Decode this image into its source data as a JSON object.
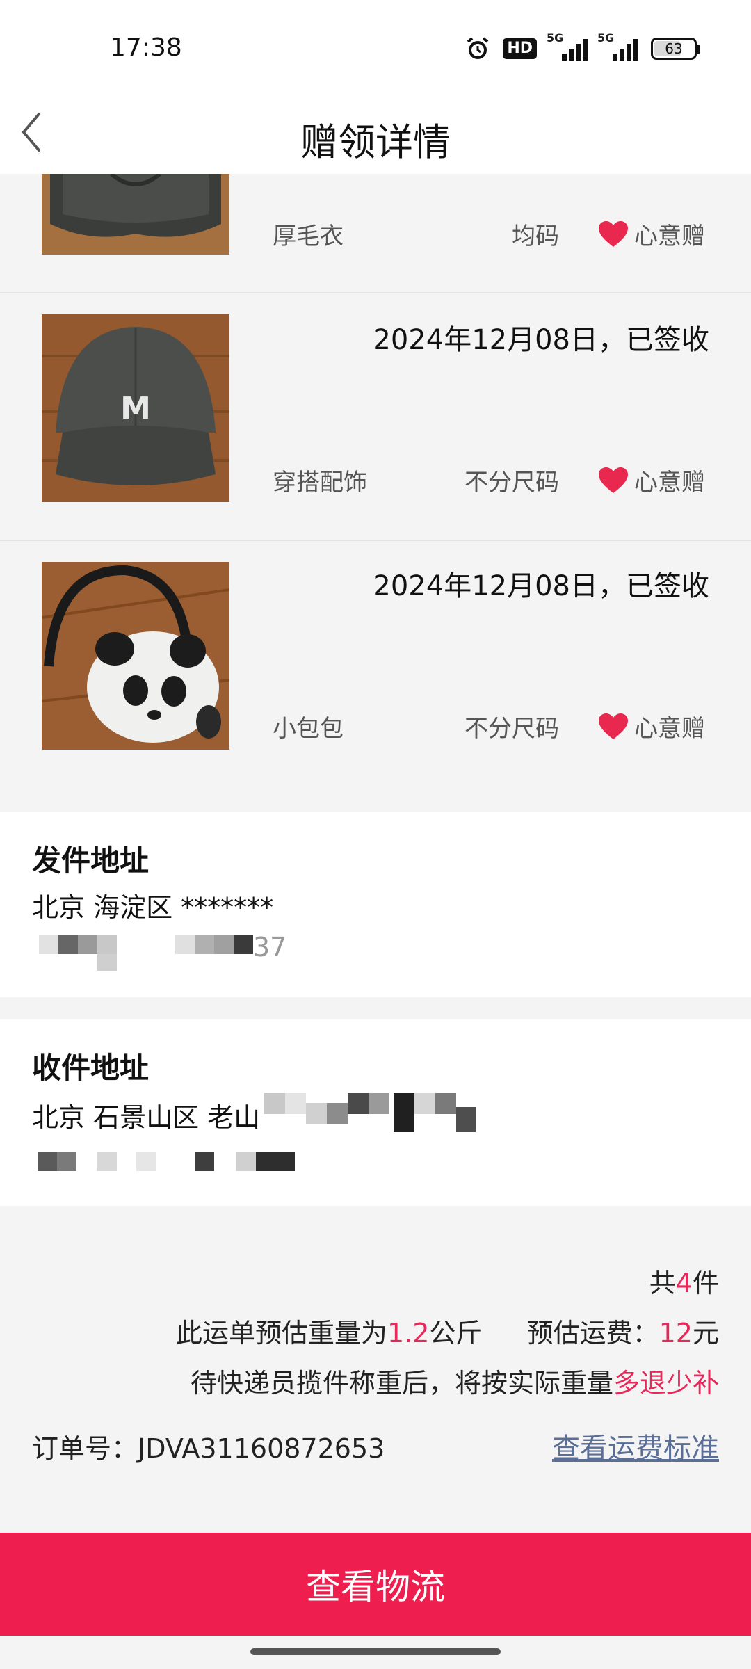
{
  "status_bar": {
    "time": "17:38",
    "hd_label": "HD",
    "network_1": "5G",
    "network_2": "5G",
    "battery": "63"
  },
  "header": {
    "title": "赠领详情",
    "back_icon": "chevron-left-icon"
  },
  "items": [
    {
      "date": "",
      "name": "厚毛衣",
      "size": "均码",
      "tag": "心意赠",
      "thumb": "dark-sweater"
    },
    {
      "date": "2024年12月08日，已签收",
      "name": "穿搭配饰",
      "size": "不分尺码",
      "tag": "心意赠",
      "thumb": "baseball-cap"
    },
    {
      "date": "2024年12月08日，已签收",
      "name": "小包包",
      "size": "不分尺码",
      "tag": "心意赠",
      "thumb": "panda-bag"
    }
  ],
  "sender": {
    "title": "发件地址",
    "line1": "北京 海淀区 *******",
    "line2_visible": "37"
  },
  "receiver": {
    "title": "收件地址",
    "line1": "北京 石景山区 老山"
  },
  "summary": {
    "count_prefix": "共",
    "count": "4",
    "count_suffix": "件",
    "weight_prefix": "此运单预估重量为",
    "weight": "1.2",
    "weight_unit": "公斤",
    "fee_prefix": "预估运费：",
    "fee": "12",
    "fee_unit": "元",
    "note_prefix": "待快递员揽件称重后，将按实际重量",
    "note_highlight": "多退少补",
    "order_label": "订单号：",
    "order_no": "JDVA31160872653",
    "fee_standard_link": "查看运费标准"
  },
  "bottom_button": {
    "label": "查看物流"
  },
  "colors": {
    "accent": "#e8285a",
    "button": "#ee1e4f",
    "link": "#5a6e96",
    "heart": "#e8284f"
  }
}
